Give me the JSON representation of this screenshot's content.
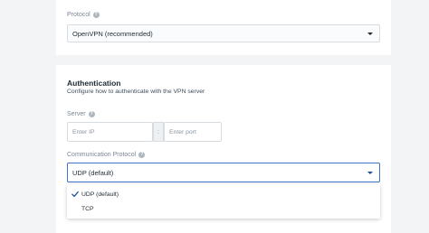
{
  "protocol_section": {
    "label": "Protocol",
    "help": "?",
    "selected": "OpenVPN (recommended)"
  },
  "authentication": {
    "title": "Authentication",
    "description": "Configure how to authenticate with the VPN server",
    "server": {
      "label": "Server",
      "help": "?",
      "ip_placeholder": "Enter IP",
      "separator": ":",
      "port_placeholder": "Enter port"
    },
    "communication_protocol": {
      "label": "Communication Protocol",
      "help": "?",
      "selected": "UDP (default)",
      "options": [
        {
          "label": "UDP (default)",
          "checked": true
        },
        {
          "label": "TCP",
          "checked": false
        }
      ]
    }
  },
  "colors": {
    "accent": "#3b73c8",
    "check": "#1d4f9c",
    "page_background": "#f3f4f5"
  }
}
